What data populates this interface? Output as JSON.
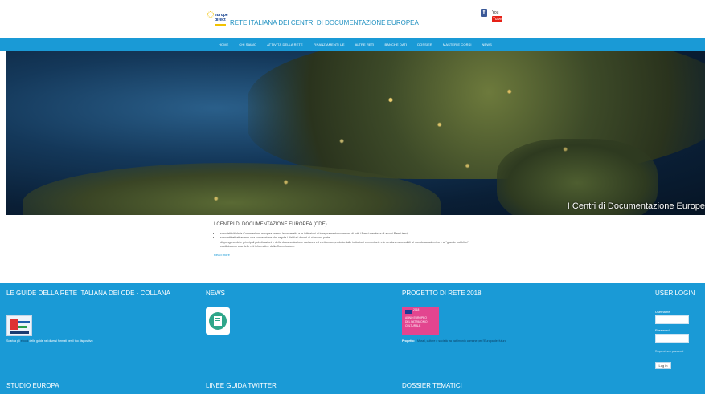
{
  "header": {
    "logo_line1": "europe",
    "logo_line2": "direct",
    "site_title": "RETE ITALIANA DEI CENTRI DI DOCUMENTAZIONE EUROPEA",
    "facebook_icon": "facebook-icon",
    "facebook_glyph": "f",
    "youtube_icon": "youtube-icon",
    "youtube_you": "You",
    "youtube_tube": "Tube"
  },
  "nav": {
    "items": [
      "HOME",
      "CHI SIAMO",
      "ATTIVITÀ DELLA RETE",
      "FINANZIAMENTI UE",
      "ALTRE RETI",
      "BANCHE DATI",
      "DOSSIER",
      "MASTER E CORSI",
      "NEWS"
    ]
  },
  "hero": {
    "caption": "I Centri di Documentazione Europe"
  },
  "intro": {
    "title": "I CENTRI DI DOCUMENTAZIONE EUROPEA (CDE)",
    "bullets": [
      "sono istituiti dalla Commissione europea presso le università e le istituzioni di insegnamento superiore di tutti i Paesi membri e di alcuni Paesi terzi;",
      "sono attivati attraverso una convenzione che regola i diritti e i doveri di ciascuna parte;",
      "dispongono delle principali pubblicazioni e della documentazione cartacea ed elettronica prodotta dalle istituzioni comunitarie e le rendono accessibili al mondo accademico e al \"grande pubblico\";",
      "costituiscono una delle reti informative della Commissione."
    ],
    "read_more": "Read more"
  },
  "footer": {
    "guides_title": "LE GUIDE DELLA RETE ITALIANA DEI CDE - COLLANA",
    "guides_text_before": "Scarica gli",
    "guides_text_link": "ebook",
    "guides_text_after": "delle guide nei diversi formati per il tuo dispositivo",
    "news_title": "NEWS",
    "project_title": "PROGETTO DI RETE 2018",
    "project_img_year": "2018",
    "project_img_line1": "ANNO EUROPEO",
    "project_img_line2": "DEL PATRIMONIO",
    "project_img_line3": "CULTURALE",
    "project_text_label": "Progetto:",
    "project_text_body": "I Musei, culture e società tra patrimonio comune per l'Europa del futuro",
    "login_title": "USER LOGIN",
    "username_label": "Username",
    "password_label": "Password",
    "forgot_link": "Request new password",
    "login_button": "Log in",
    "studio_title": "STUDIO EUROPA",
    "twitter_title": "LINEE GUIDA TWITTER",
    "dossier_title": "DOSSIER TEMATICI"
  },
  "colors": {
    "accent": "#1a9ad6",
    "title_blue": "#1d8fc0",
    "project_pink": "#e3458f"
  }
}
